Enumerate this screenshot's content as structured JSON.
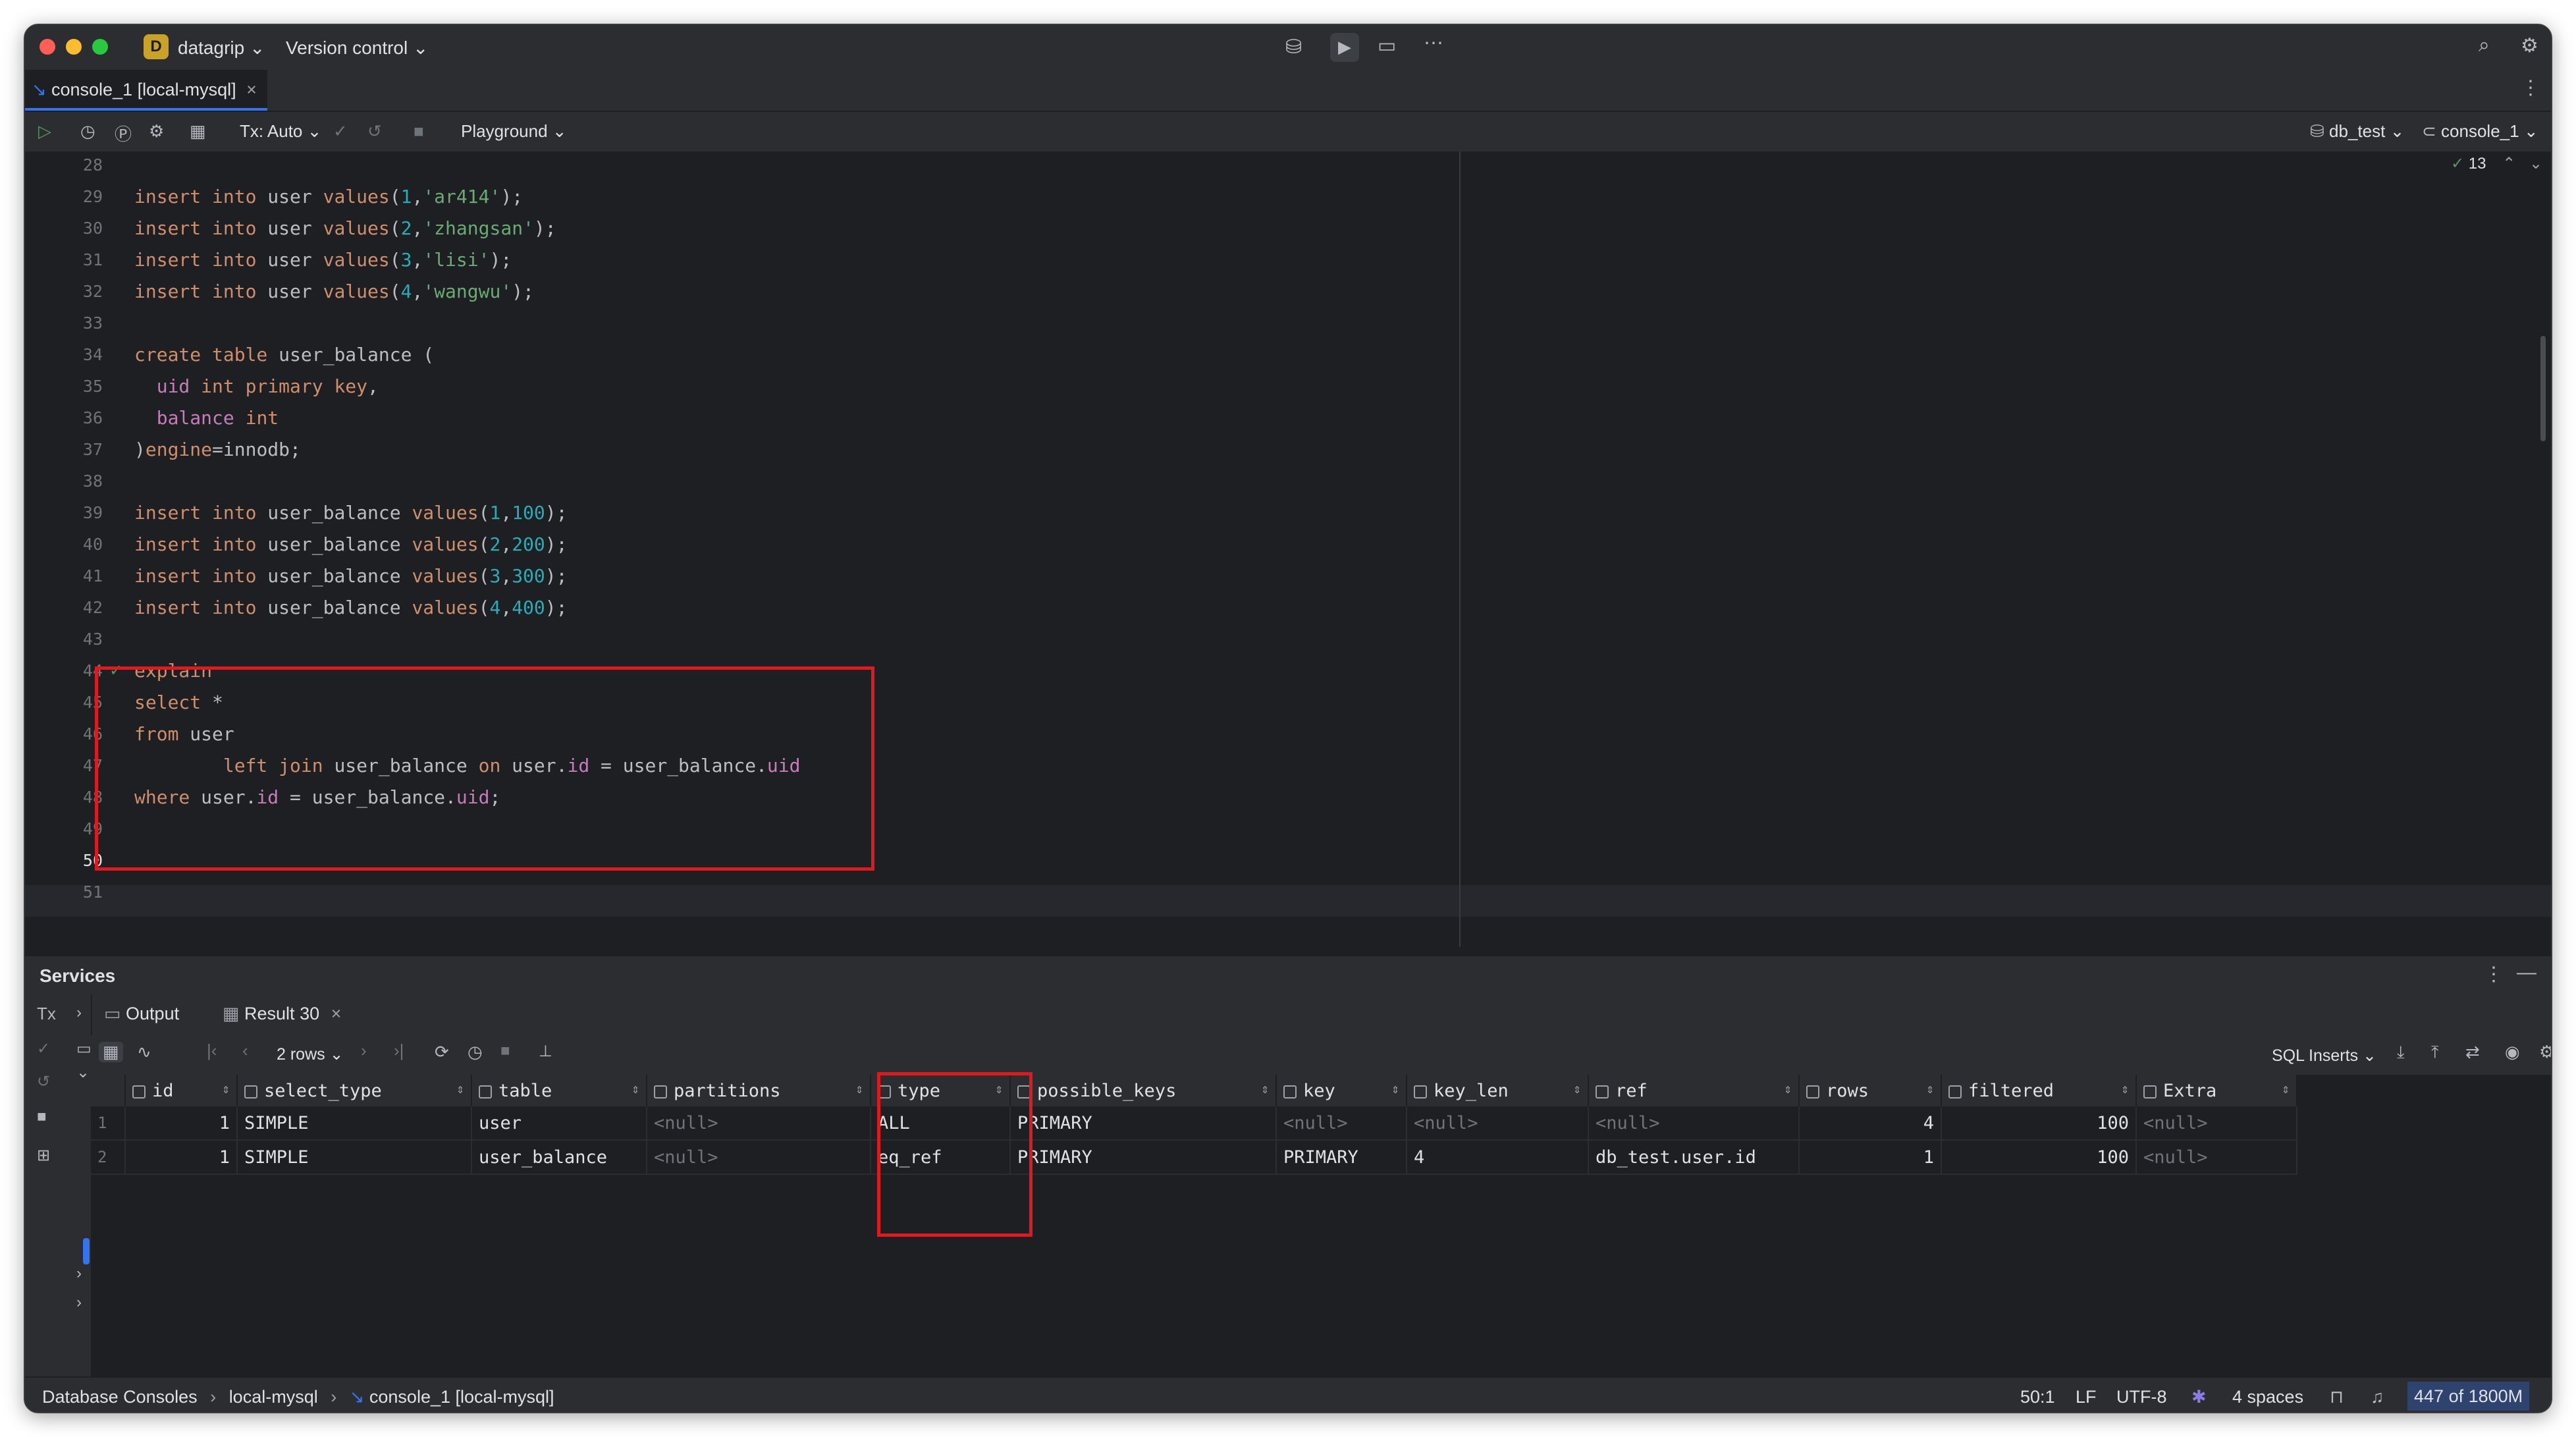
{
  "window": {
    "project_initial": "D",
    "project_name": "datagrip",
    "vcs_label": "Version control"
  },
  "editor_tab": {
    "label": "console_1 [local-mysql]",
    "close": "×"
  },
  "toolbar": {
    "tx_label": "Tx: Auto",
    "playground_label": "Playground",
    "db_selector": "db_test",
    "console_selector": "console_1"
  },
  "inspection": {
    "count": "13"
  },
  "code": {
    "line_numbers": [
      "28",
      "29",
      "30",
      "31",
      "32",
      "33",
      "34",
      "35",
      "36",
      "37",
      "38",
      "39",
      "40",
      "41",
      "42",
      "43",
      "44",
      "45",
      "46",
      "47",
      "48",
      "49",
      "50",
      "51"
    ],
    "caret_line": "50"
  },
  "services": {
    "title": "Services",
    "tab_output": "Output",
    "tab_result": "Result 30",
    "rows_label": "2 rows",
    "export_label": "SQL Inserts"
  },
  "results": {
    "columns": [
      "id",
      "select_type",
      "table",
      "partitions",
      "type",
      "possible_keys",
      "key",
      "key_len",
      "ref",
      "rows",
      "filtered",
      "Extra"
    ],
    "rows": [
      [
        "1",
        "1",
        "SIMPLE",
        "user",
        "<null>",
        "ALL",
        "PRIMARY",
        "<null>",
        "<null>",
        "<null>",
        "4",
        "100",
        "<null>"
      ],
      [
        "2",
        "1",
        "SIMPLE",
        "user_balance",
        "<null>",
        "eq_ref",
        "PRIMARY",
        "PRIMARY",
        "4",
        "db_test.user.id",
        "1",
        "100",
        "<null>"
      ]
    ]
  },
  "statusbar": {
    "crumb1": "Database Consoles",
    "crumb2": "local-mysql",
    "crumb3": "console_1 [local-mysql]",
    "position": "50:1",
    "line_sep": "LF",
    "encoding": "UTF-8",
    "indent": "4 spaces",
    "memory_used": "447",
    "memory_total": "of 1800M"
  },
  "colors": {
    "accent": "#3574f0",
    "highlight_box": "#e0191f",
    "keyword": "#cf8e6d",
    "number": "#2aacb8",
    "string": "#6aab73"
  }
}
